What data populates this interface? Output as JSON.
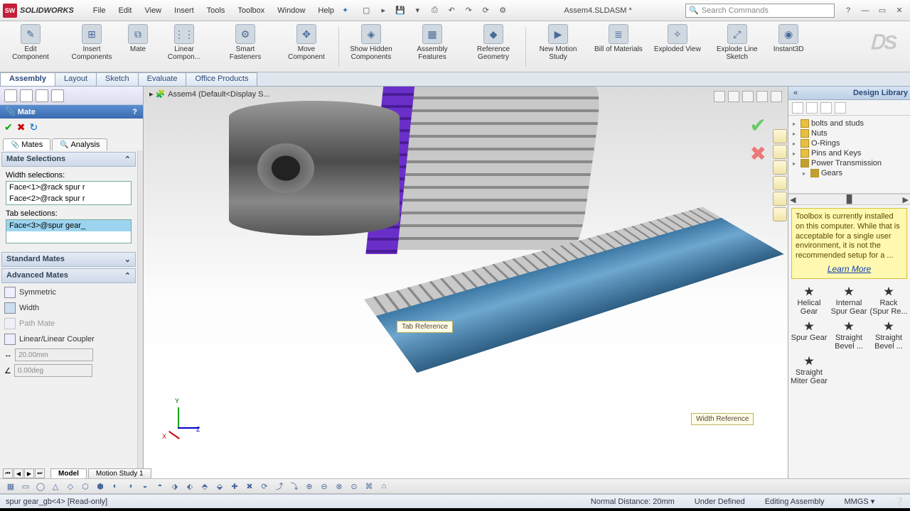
{
  "app": {
    "name": "SOLIDWORKS",
    "doc_title": "Assem4.SLDASM *",
    "search_placeholder": "Search Commands"
  },
  "menu": [
    "File",
    "Edit",
    "View",
    "Insert",
    "Tools",
    "Toolbox",
    "Window",
    "Help"
  ],
  "ribbon": [
    {
      "label": "Edit Component"
    },
    {
      "label": "Insert Components"
    },
    {
      "label": "Mate"
    },
    {
      "label": "Linear Compon..."
    },
    {
      "label": "Smart Fasteners"
    },
    {
      "label": "Move Component"
    },
    {
      "label": "Show Hidden Components"
    },
    {
      "label": "Assembly Features"
    },
    {
      "label": "Reference Geometry"
    },
    {
      "label": "New Motion Study"
    },
    {
      "label": "Bill of Materials"
    },
    {
      "label": "Exploded View"
    },
    {
      "label": "Explode Line Sketch"
    },
    {
      "label": "Instant3D"
    }
  ],
  "cmd_tabs": [
    "Assembly",
    "Layout",
    "Sketch",
    "Evaluate",
    "Office Products"
  ],
  "pm": {
    "title": "Mate",
    "sub_tabs": [
      "Mates",
      "Analysis"
    ],
    "sec_selections": "Mate Selections",
    "width_label": "Width selections:",
    "width_items": [
      "Face<1>@rack spur r",
      "Face<2>@rack spur r"
    ],
    "tab_label": "Tab selections:",
    "tab_items": [
      "Face<3>@spur gear_"
    ],
    "sec_std": "Standard Mates",
    "sec_adv": "Advanced Mates",
    "adv": [
      "Symmetric",
      "Width",
      "Path Mate",
      "Linear/Linear Coupler"
    ],
    "dist": "20.00mm",
    "ang": "0.00deg"
  },
  "crumb": "Assem4 (Default<Display S...",
  "callouts": {
    "tab": "Tab Reference",
    "width": "Width Reference"
  },
  "taskpane": {
    "title": "Design Library",
    "tree": [
      "bolts and studs",
      "Nuts",
      "O-Rings",
      "Pins and Keys",
      "Power Transmission",
      "Gears"
    ],
    "tip": "Toolbox is currently installed on this computer. While that is acceptable for a single user environment, it is not the recommended setup for a ...",
    "learn": "Learn More",
    "gears": [
      "Helical Gear",
      "Internal Spur Gear",
      "Rack (Spur Re...",
      "Spur Gear",
      "Straight Bevel ...",
      "Straight Bevel ...",
      "Straight Miter Gear"
    ]
  },
  "view_tabs": [
    "Model",
    "Motion Study 1"
  ],
  "status": {
    "left": "spur gear_gb<4> [Read-only]",
    "dist": "Normal Distance: 20mm",
    "def": "Under Defined",
    "mode": "Editing Assembly",
    "units": "MMGS"
  }
}
